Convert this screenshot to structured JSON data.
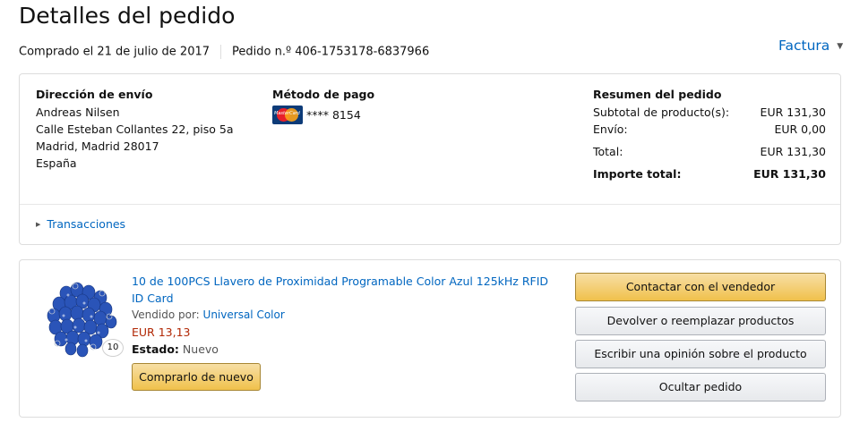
{
  "page": {
    "title": "Detalles del pedido",
    "purchased": "Comprado el 21 de julio de 2017",
    "order_number": "Pedido n.º 406-1753178-6837966",
    "invoice_label": "Factura"
  },
  "shipping": {
    "heading": "Dirección de envío",
    "lines": [
      "Andreas Nilsen",
      "Calle Esteban Collantes 22, piso 5a",
      "Madrid, Madrid 28017",
      "España"
    ]
  },
  "payment": {
    "heading": "Método de pago",
    "card_brand_text": "MasterCard",
    "card_number": "**** 8154",
    "card_icon": "mastercard-icon"
  },
  "summary": {
    "heading": "Resumen del pedido",
    "rows": [
      {
        "label": "Subtotal de producto(s):",
        "value": "EUR 131,30"
      },
      {
        "label": "Envío:",
        "value": "EUR 0,00"
      },
      {
        "label": "Total:",
        "value": "EUR 131,30"
      },
      {
        "label": "Importe total:",
        "value": "EUR 131,30"
      }
    ]
  },
  "transactions": {
    "label": "Transacciones"
  },
  "item": {
    "title": "10 de 100PCS Llavero de Proximidad Programable Color Azul 125kHz RFID ID Card",
    "quantity": "10",
    "sold_by_label": "Vendido por:",
    "seller": "Universal Color",
    "price": "EUR 13,13",
    "status_label": "Estado:",
    "status_value": "Nuevo",
    "buy_again": "Comprarlo de nuevo"
  },
  "actions": {
    "contact_seller": "Contactar con el vendedor",
    "return_replace": "Devolver o reemplazar productos",
    "write_review": "Escribir una opinión sobre el producto",
    "hide_order": "Ocultar pedido"
  },
  "colors": {
    "link": "#0066c0",
    "price": "#b12704",
    "button_yellow": "#f0c14b",
    "keyfob_blue": "#2a54b8"
  }
}
